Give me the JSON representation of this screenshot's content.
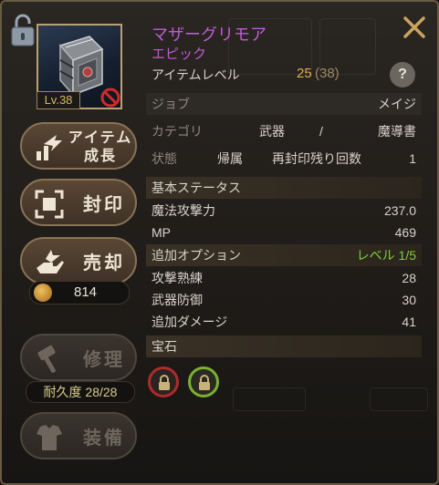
{
  "item": {
    "name": "マザーグリモア",
    "rank": "エピック",
    "level_badge": "Lv.38",
    "item_level_label": "アイテムレベル",
    "item_level": "25",
    "item_level_max": "(38)"
  },
  "rows": {
    "job": {
      "label": "ジョブ",
      "value": "メイジ"
    },
    "category": {
      "label": "カテゴリ",
      "value1": "武器",
      "sep": "/",
      "value2": "魔導書"
    },
    "state": {
      "label": "状態",
      "value": "帰属",
      "reseal_label": "再封印残り回数",
      "reseal_count": "1"
    }
  },
  "base_status": {
    "header": "基本ステータス",
    "items": [
      {
        "label": "魔法攻撃力",
        "value": "237.0"
      },
      {
        "label": "MP",
        "value": "469"
      }
    ]
  },
  "extra_options": {
    "header": "追加オプション",
    "level_text": "レベル 1/5",
    "items": [
      {
        "label": "攻撃熟練",
        "value": "28"
      },
      {
        "label": "武器防御",
        "value": "30"
      },
      {
        "label": "追加ダメージ",
        "value": "41"
      }
    ]
  },
  "gems": {
    "header": "宝石"
  },
  "buttons": {
    "grow": "アイテム\n成長",
    "grow_l1": "アイテム",
    "grow_l2": "成長",
    "seal": "封印",
    "sell": "売却",
    "sell_price": "814",
    "repair": "修理",
    "durability": "耐久度 28/28",
    "equip": "装備"
  },
  "colors": {
    "epic": "#c05ad6",
    "gold": "#e0b04a",
    "green_opt": "#7ccf3c",
    "panel_border": "#6b5a44"
  }
}
